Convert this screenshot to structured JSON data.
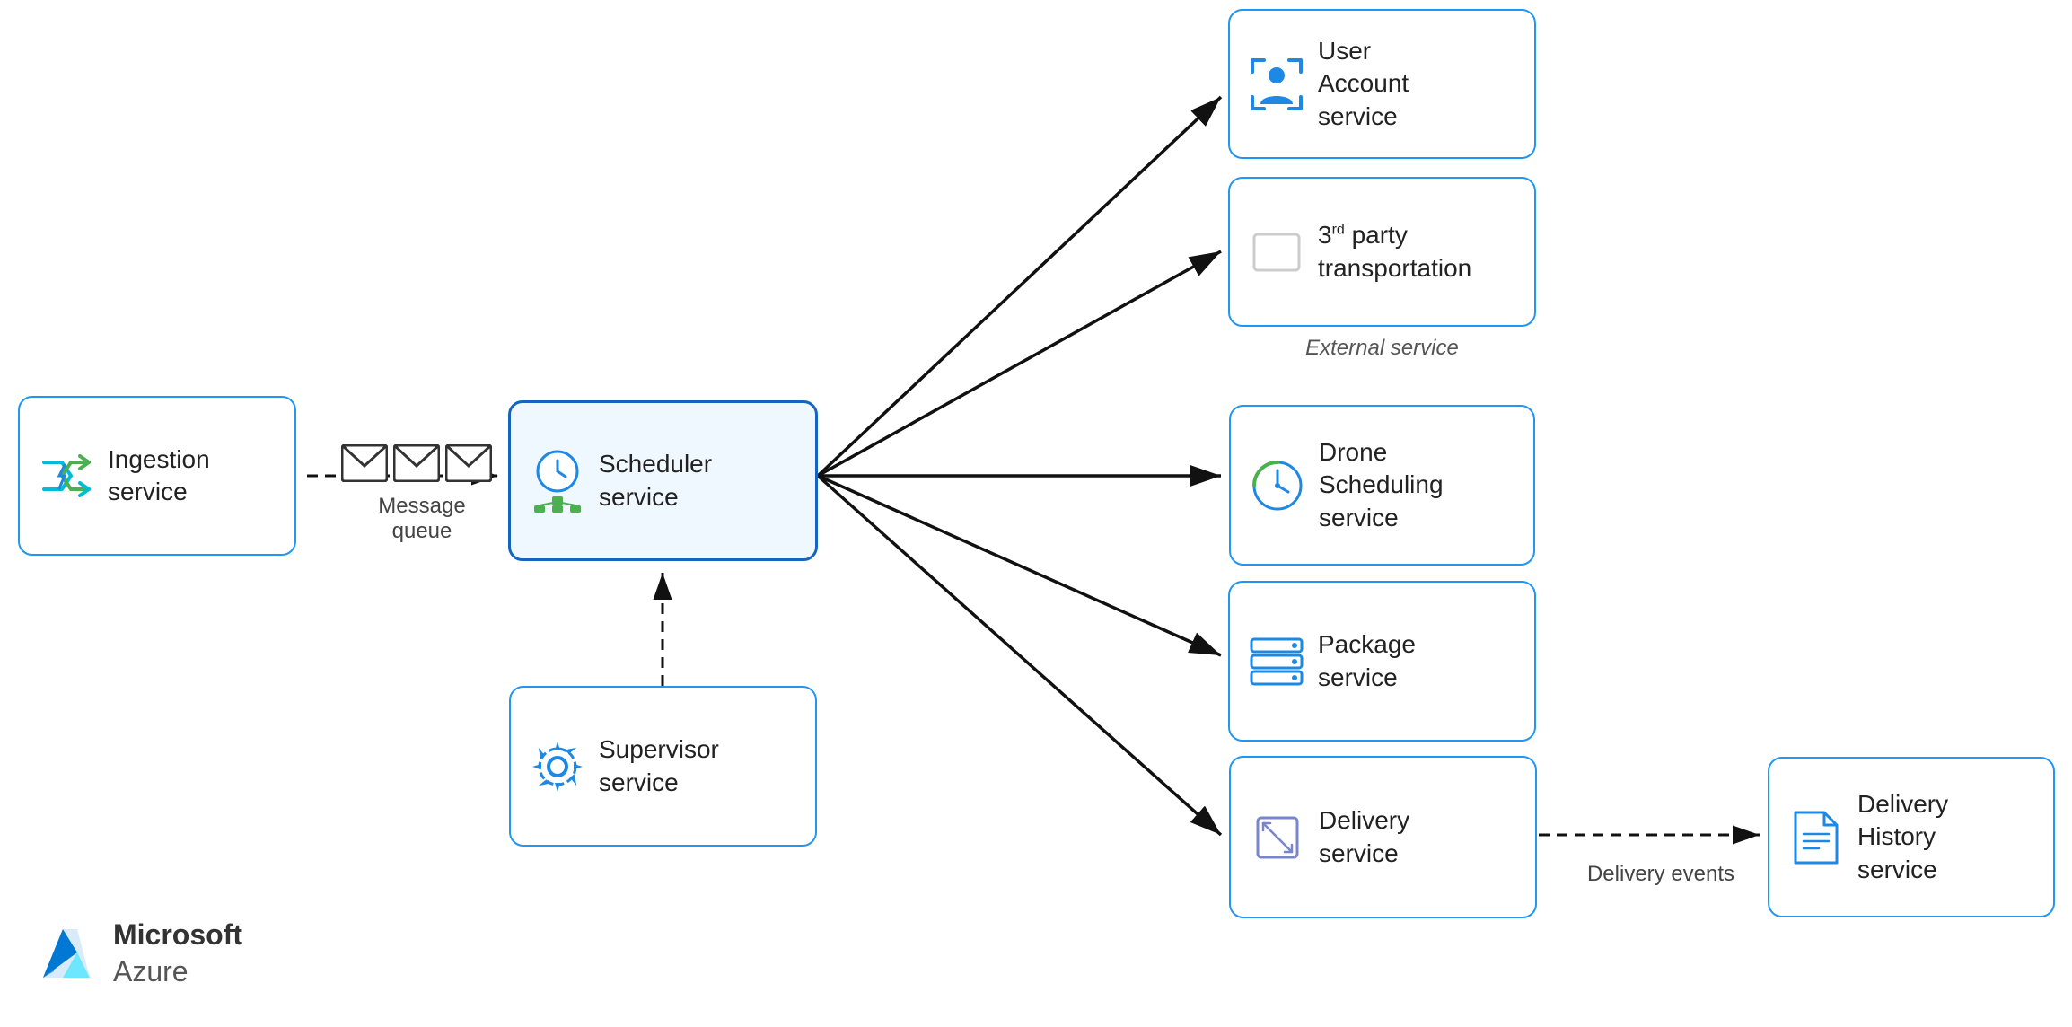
{
  "services": {
    "ingestion": {
      "label": "Ingestion\nservice",
      "label_line1": "Ingestion",
      "label_line2": "service"
    },
    "scheduler": {
      "label_line1": "Scheduler",
      "label_line2": "service"
    },
    "supervisor": {
      "label_line1": "Supervisor",
      "label_line2": "service"
    },
    "user_account": {
      "label_line1": "User",
      "label_line2": "Account",
      "label_line3": "service"
    },
    "third_party": {
      "label_line1": "3rd party",
      "label_line2": "transportation",
      "caption": "External service"
    },
    "drone_scheduling": {
      "label_line1": "Drone",
      "label_line2": "Scheduling",
      "label_line3": "service"
    },
    "package": {
      "label_line1": "Package",
      "label_line2": "service"
    },
    "delivery": {
      "label_line1": "Delivery",
      "label_line2": "service"
    },
    "delivery_history": {
      "label_line1": "Delivery",
      "label_line2": "History",
      "label_line3": "service"
    }
  },
  "captions": {
    "message_queue": "Message\nqueue",
    "message_queue_line1": "Message",
    "message_queue_line2": "queue",
    "delivery_events": "Delivery events",
    "external_service": "External service"
  },
  "colors": {
    "blue": "#1E88E5",
    "dark_blue": "#1565C0",
    "border": "#2196F3",
    "arrow": "#111111"
  }
}
